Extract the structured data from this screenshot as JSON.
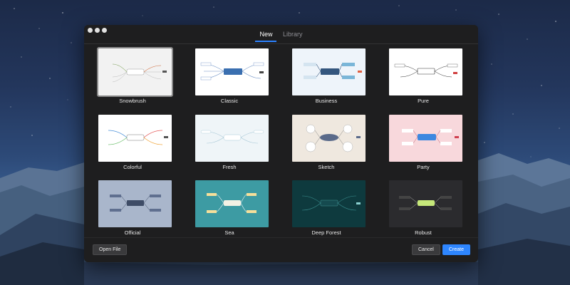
{
  "window": {
    "tabs": [
      {
        "label": "New",
        "active": true
      },
      {
        "label": "Library",
        "active": false
      }
    ]
  },
  "templates": [
    {
      "name": "Snowbrush",
      "selected": true
    },
    {
      "name": "Classic",
      "selected": false
    },
    {
      "name": "Business",
      "selected": false
    },
    {
      "name": "Pure",
      "selected": false
    },
    {
      "name": "Colorful",
      "selected": false
    },
    {
      "name": "Fresh",
      "selected": false
    },
    {
      "name": "Sketch",
      "selected": false
    },
    {
      "name": "Party",
      "selected": false
    },
    {
      "name": "Official",
      "selected": false
    },
    {
      "name": "Sea",
      "selected": false
    },
    {
      "name": "Deep Forest",
      "selected": false
    },
    {
      "name": "Robust",
      "selected": false
    }
  ],
  "footer": {
    "open_file": "Open File",
    "cancel": "Cancel",
    "create": "Create"
  },
  "colors": {
    "accent": "#2e86ff",
    "window_bg": "#1e1e1f"
  }
}
